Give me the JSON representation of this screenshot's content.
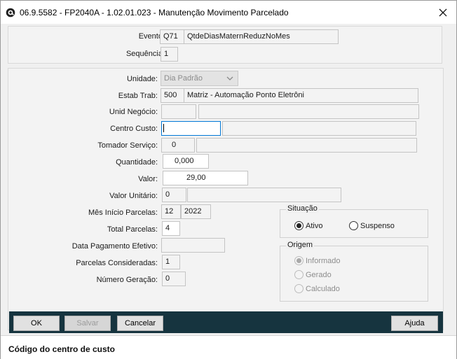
{
  "window": {
    "title": "06.9.5582 - FP2040A - 1.02.01.023 - Manutenção Movimento Parcelado",
    "icon": "totvs-logo-icon"
  },
  "header": {
    "evento_label": "Evento:",
    "evento_code": "Q71",
    "evento_desc": "QtdeDiasMaternReduzNoMes",
    "sequencia_label": "Sequência:",
    "sequencia_value": "1"
  },
  "form": {
    "unidade_label": "Unidade:",
    "unidade_value": "Dia Padrão",
    "estab_label": "Estab Trab:",
    "estab_code": "500",
    "estab_desc": "Matriz - Automação Ponto Eletrôni",
    "unid_negocio_label": "Unid Negócio:",
    "unid_negocio_code": "",
    "unid_negocio_desc": "",
    "centro_custo_label": "Centro Custo:",
    "centro_custo_code": "",
    "centro_custo_desc": "",
    "tomador_label": "Tomador Serviço:",
    "tomador_code": "0",
    "tomador_desc": "",
    "quantidade_label": "Quantidade:",
    "quantidade_value": "0,000",
    "valor_label": "Valor:",
    "valor_value": "29,00",
    "valor_unitario_label": "Valor Unitário:",
    "valor_unitario_value": "0",
    "valor_unitario_desc": "",
    "mes_inicio_label": "Mês Início Parcelas:",
    "mes_inicio_month": "12",
    "mes_inicio_year": "2022",
    "total_parcelas_label": "Total Parcelas:",
    "total_parcelas_value": "4",
    "data_pagamento_label": "Data Pagamento Efetivo:",
    "data_pagamento_value": "",
    "parcelas_consideradas_label": "Parcelas Consideradas:",
    "parcelas_consideradas_value": "1",
    "numero_geracao_label": "Número Geração:",
    "numero_geracao_value": "0"
  },
  "situacao": {
    "title": "Situação",
    "options": [
      "Ativo",
      "Suspenso"
    ],
    "selected": "Ativo"
  },
  "origem": {
    "title": "Origem",
    "options": [
      "Informado",
      "Gerado",
      "Calculado"
    ],
    "selected": "Informado"
  },
  "buttons": {
    "ok": "OK",
    "salvar": "Salvar",
    "cancelar": "Cancelar",
    "ajuda": "Ajuda"
  },
  "status": {
    "text": "Código do centro de custo"
  },
  "colors": {
    "button_bar": "#16343f",
    "focus_border": "#0078d7"
  }
}
